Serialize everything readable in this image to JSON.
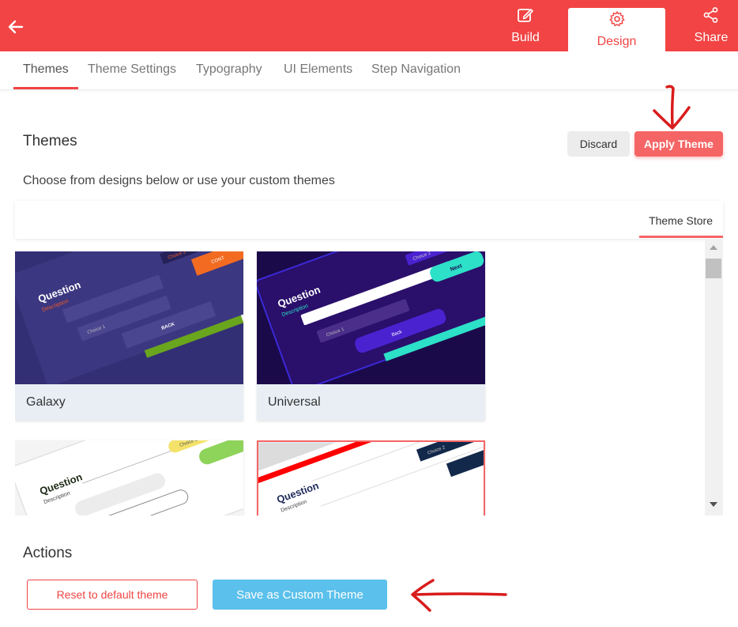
{
  "header": {
    "tabs": [
      {
        "label": "Build",
        "icon": "edit-icon"
      },
      {
        "label": "Design",
        "icon": "gear-icon"
      },
      {
        "label": "Share",
        "icon": "share-icon"
      }
    ],
    "accent": "#f24444"
  },
  "subnav": {
    "items": [
      "Themes",
      "Theme Settings",
      "Typography",
      "UI Elements",
      "Step Navigation"
    ],
    "active": "Themes"
  },
  "themes_section": {
    "title": "Themes",
    "discard_label": "Discard",
    "apply_label": "Apply Theme",
    "subtitle": "Choose from designs below or use your custom themes",
    "store_tab": "Theme Store"
  },
  "themes": [
    {
      "name": "Galaxy",
      "preview": {
        "question": "Question",
        "description": "Description",
        "choice1": "Choice 1",
        "choice2": "Choice 2",
        "back": "BACK",
        "next": "CONT"
      }
    },
    {
      "name": "Universal",
      "preview": {
        "question": "Question",
        "description": "Description",
        "choice1": "Choice 1",
        "choice2": "Choice 2",
        "back": "Back",
        "next": "Next"
      }
    },
    {
      "name": "",
      "preview": {
        "question": "Question",
        "description": "Description",
        "choice2": "Choice 2"
      }
    },
    {
      "name": "",
      "preview": {
        "question": "Question",
        "description": "Description",
        "choice2": "Choice 2"
      }
    }
  ],
  "actions": {
    "title": "Actions",
    "reset_label": "Reset to default theme",
    "save_label": "Save as Custom Theme"
  },
  "colors": {
    "primary_red": "#f24444",
    "apply_button": "#f56565",
    "save_button": "#5bc0eb",
    "annotation_arrow": "#d91c1c"
  }
}
